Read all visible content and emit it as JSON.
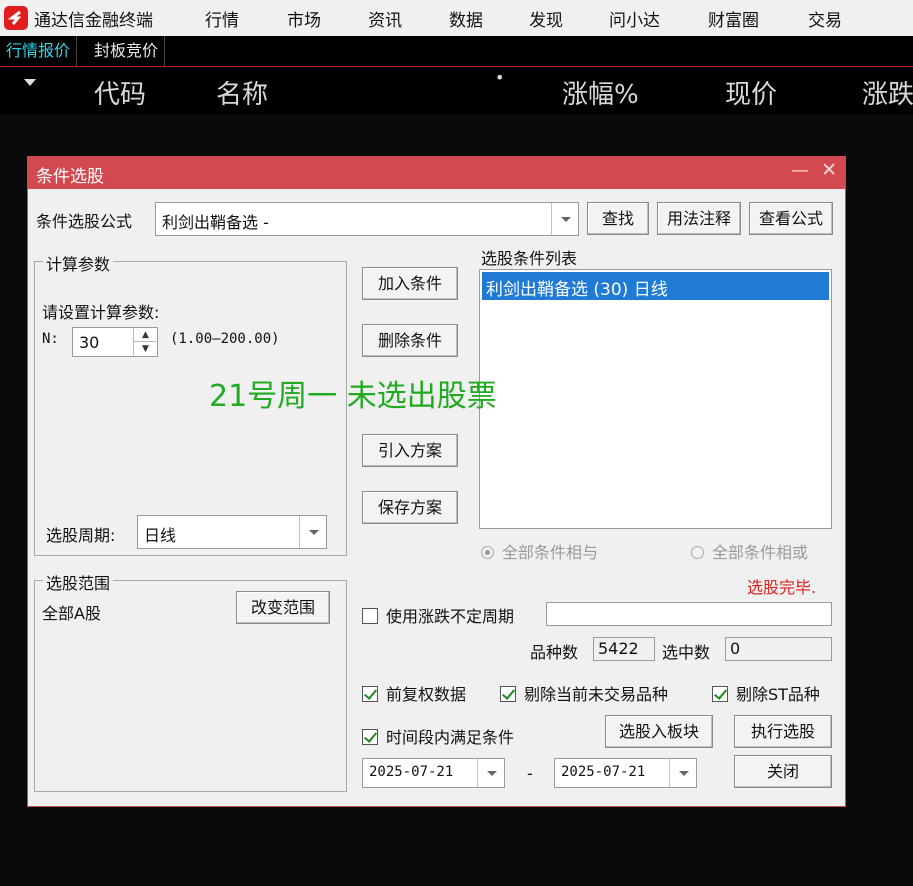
{
  "app": {
    "title": "通达信金融终端",
    "menu": [
      "行情",
      "市场",
      "资讯",
      "数据",
      "发现",
      "问小达",
      "财富圈",
      "交易"
    ]
  },
  "tabs": [
    "行情报价",
    "封板竞价"
  ],
  "table_header": {
    "columns": [
      "代码",
      "名称",
      "涨幅%",
      "现价",
      "涨跌"
    ],
    "dot": "•"
  },
  "dialog": {
    "title": "条件选股",
    "formula_label": "条件选股公式",
    "formula_value": "利剑出鞘备选  -",
    "buttons": {
      "find": "查找",
      "usage": "用法注释",
      "view_formula": "查看公式",
      "add_condition": "加入条件",
      "delete_condition": "删除条件",
      "import_plan": "引入方案",
      "save_plan": "保存方案",
      "change_range": "改变范围",
      "to_block": "选股入板块",
      "execute": "执行选股",
      "close": "关闭"
    },
    "params": {
      "group_label": "计算参数",
      "prompt": "请设置计算参数:",
      "n_label": "N:",
      "n_value": "30",
      "n_range": "(1.00—200.00)"
    },
    "period": {
      "label": "选股周期:",
      "value": "日线"
    },
    "range": {
      "group_label": "选股范围",
      "value": "全部A股"
    },
    "condition_list": {
      "label": "选股条件列表",
      "items": [
        "利剑出鞘备选 (30) 日线"
      ]
    },
    "logic": {
      "and_label": "全部条件相与",
      "or_label": "全部条件相或",
      "selected": "and"
    },
    "status": "选股完毕.",
    "uncertain_period": {
      "label": "使用涨跌不定周期",
      "checked": false,
      "value": ""
    },
    "counts": {
      "total_label": "品种数",
      "total_value": "5422",
      "selected_label": "选中数",
      "selected_value": "0"
    },
    "options": {
      "forward_adjust": {
        "label": "前复权数据",
        "checked": true
      },
      "exclude_non_trading": {
        "label": "剔除当前未交易品种",
        "checked": true
      },
      "exclude_st": {
        "label": "剔除ST品种",
        "checked": true
      },
      "time_period": {
        "label": "时间段内满足条件",
        "checked": true
      }
    },
    "date_from": "2025-07-21",
    "date_sep": "-",
    "date_to": "2025-07-21"
  },
  "annotation": "21号周一 未选出股票",
  "colors": {
    "dialog_title_bar": "#d24a4f",
    "selection": "#1f7bd6",
    "status_red": "#e0201c",
    "annotation_green": "#1faa1f",
    "tab_active": "#2fd4e8"
  }
}
